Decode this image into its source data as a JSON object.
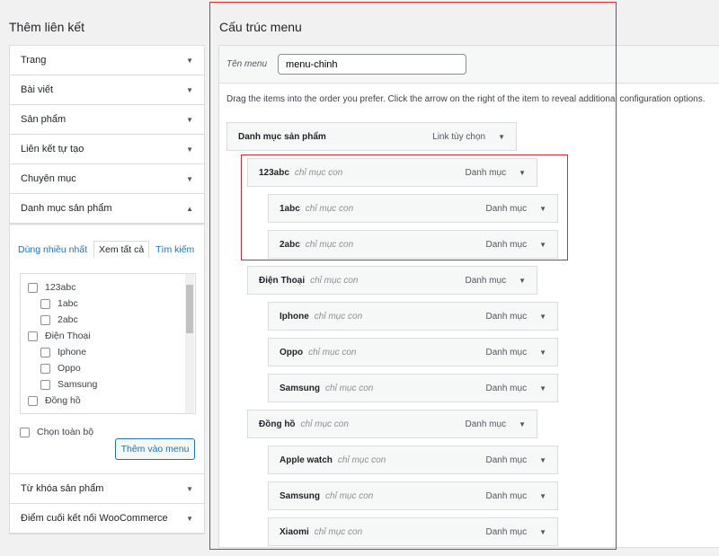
{
  "left": {
    "title": "Thêm liên kết",
    "sections": [
      "Trang",
      "Bài viết",
      "Sản phẩm",
      "Liên kết tự tạo",
      "Chuyên mục",
      "Danh mục sản phẩm"
    ],
    "bottom_sections": [
      "Từ khóa sản phẩm",
      "Điểm cuối kết nối WooCommerce"
    ],
    "tabs": [
      "Dùng nhiều nhất",
      "Xem tất cả",
      "Tìm kiếm"
    ],
    "checklist": [
      {
        "label": "123abc",
        "depth": 0
      },
      {
        "label": "1abc",
        "depth": 1
      },
      {
        "label": "2abc",
        "depth": 1
      },
      {
        "label": "Điện Thoại",
        "depth": 0
      },
      {
        "label": "Iphone",
        "depth": 1
      },
      {
        "label": "Oppo",
        "depth": 1
      },
      {
        "label": "Samsung",
        "depth": 1
      },
      {
        "label": "Đồng hồ",
        "depth": 0
      }
    ],
    "select_all": "Chọn toàn bộ",
    "add_button": "Thêm vào menu"
  },
  "right": {
    "title": "Cấu trúc menu",
    "menu_name_label": "Tên menu",
    "menu_name_value": "menu-chinh",
    "instructions": "Drag the items into the order you prefer. Click the arrow on the right of the item to reveal additional configuration options.",
    "items": [
      {
        "title": "Danh mục sản phẩm",
        "sub": "",
        "type": "Link tùy chọn",
        "depth": 0
      },
      {
        "title": "123abc",
        "sub": "chỉ mục con",
        "type": "Danh mục",
        "depth": 1
      },
      {
        "title": "1abc",
        "sub": "chỉ mục con",
        "type": "Danh mục",
        "depth": 2
      },
      {
        "title": "2abc",
        "sub": "chỉ mục con",
        "type": "Danh mục",
        "depth": 2
      },
      {
        "title": "Điện Thoại",
        "sub": "chỉ mục con",
        "type": "Danh mục",
        "depth": 1
      },
      {
        "title": "Iphone",
        "sub": "chỉ mục con",
        "type": "Danh mục",
        "depth": 2
      },
      {
        "title": "Oppo",
        "sub": "chỉ mục con",
        "type": "Danh mục",
        "depth": 2
      },
      {
        "title": "Samsung",
        "sub": "chỉ mục con",
        "type": "Danh mục",
        "depth": 2
      },
      {
        "title": "Đồng hồ",
        "sub": "chỉ mục con",
        "type": "Danh mục",
        "depth": 1
      },
      {
        "title": "Apple watch",
        "sub": "chỉ mục con",
        "type": "Danh mục",
        "depth": 2
      },
      {
        "title": "Samsung",
        "sub": "chỉ mục con",
        "type": "Danh mục",
        "depth": 2
      },
      {
        "title": "Xiaomi",
        "sub": "chỉ mục con",
        "type": "Danh mục",
        "depth": 2
      }
    ]
  },
  "colors": {
    "highlight": "#e3262f",
    "link": "#2271b1"
  }
}
